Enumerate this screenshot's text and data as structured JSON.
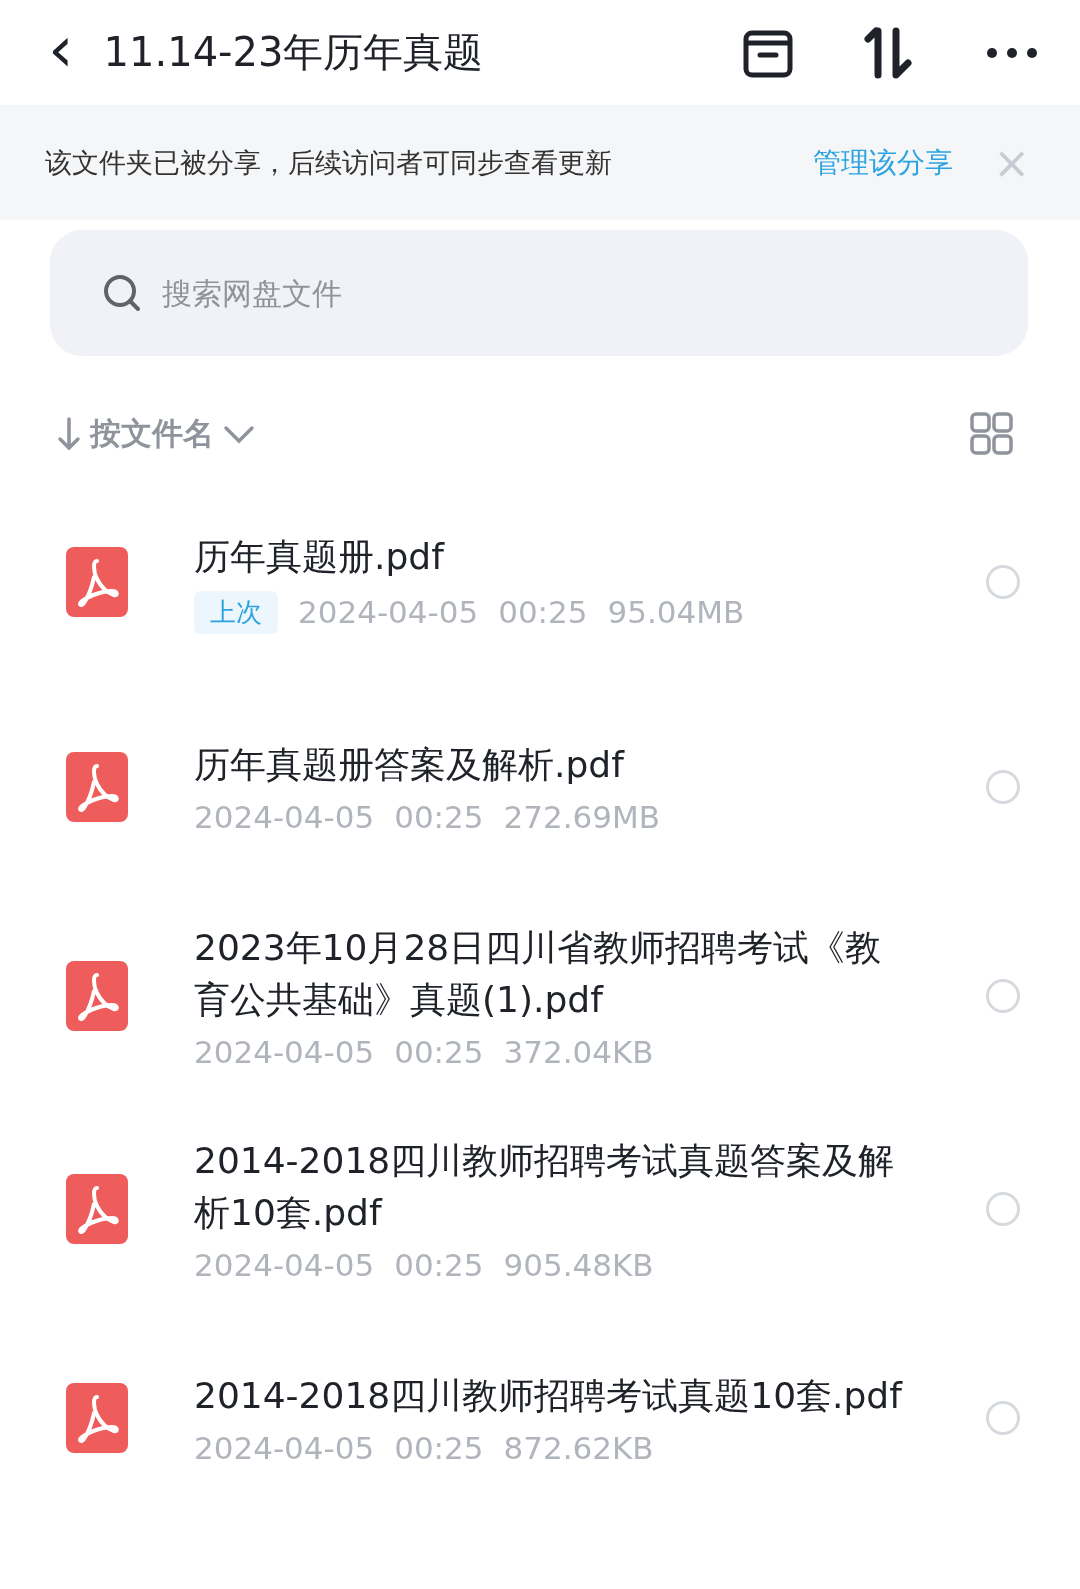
{
  "header": {
    "back": "‹",
    "title": "11.14-23年历年真题"
  },
  "share_banner": {
    "text": "该文件夹已被分享，后续访问者可同步查看更新",
    "link": "管理该分享",
    "close": "×"
  },
  "search": {
    "placeholder": "搜索网盘文件"
  },
  "sort": {
    "label": "按文件名"
  },
  "files": [
    {
      "name": "历年真题册.pdf",
      "badge": "上次",
      "date": "2024-04-05",
      "time": "00:25",
      "size": "95.04MB",
      "selected": false
    },
    {
      "name": "历年真题册答案及解析.pdf",
      "date": "2024-04-05",
      "time": "00:25",
      "size": "272.69MB",
      "selected": false
    },
    {
      "name": "2023年10月28日四川省教师招聘考试《教育公共基础》真题(1).pdf",
      "date": "2024-04-05",
      "time": "00:25",
      "size": "372.04KB",
      "selected": false
    },
    {
      "name": "2014-2018四川教师招聘考试真题答案及解析10套.pdf",
      "date": "2024-04-05",
      "time": "00:25",
      "size": "905.48KB",
      "selected": false
    },
    {
      "name": "2014-2018四川教师招聘考试真题10套.pdf",
      "date": "2024-04-05",
      "time": "00:25",
      "size": "872.62KB",
      "selected": false
    }
  ]
}
